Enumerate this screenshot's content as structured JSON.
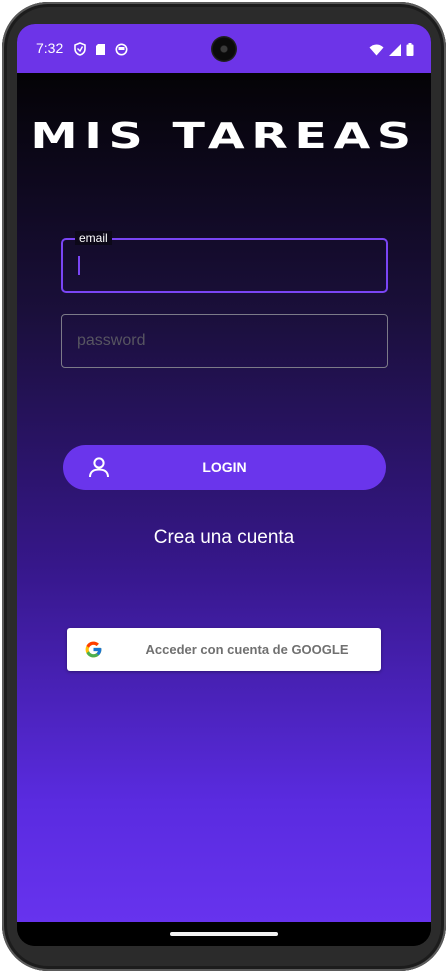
{
  "status_bar": {
    "time": "7:32",
    "left_icons": [
      "shield-icon",
      "sd-card-icon",
      "circle-status-icon"
    ],
    "right_icons": [
      "wifi-icon",
      "signal-icon",
      "battery-icon"
    ]
  },
  "app": {
    "title": "MIS TAREAS"
  },
  "form": {
    "email_label": "email",
    "email_value": "",
    "password_placeholder": "password",
    "password_value": ""
  },
  "buttons": {
    "login_label": "LOGIN",
    "create_account_label": "Crea una cuenta",
    "google_label": "Acceder con cuenta de GOOGLE"
  },
  "icons": {
    "login": "person-icon",
    "google": "google-icon"
  },
  "colors": {
    "accent": "#6d34e8",
    "button": "#6a35ec",
    "focus_border": "#7a45f5"
  }
}
